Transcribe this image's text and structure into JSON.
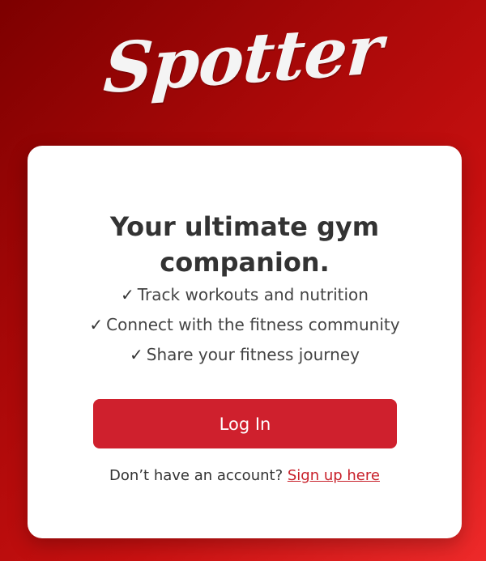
{
  "brand": {
    "logo_text": "Spotter",
    "background_gradient": [
      "#7d0000",
      "#a80808",
      "#c81010",
      "#ee2a2a"
    ]
  },
  "card": {
    "headline": "Your ultimate gym companion.",
    "features": [
      {
        "icon": "checkmark-icon",
        "check": "✓",
        "text": "Track workouts and nutrition"
      },
      {
        "icon": "checkmark-icon",
        "check": "✓",
        "text": "Connect with the fitness community"
      },
      {
        "icon": "checkmark-icon",
        "check": "✓",
        "text": "Share your fitness journey"
      }
    ],
    "login_button_label": "Log In",
    "login_button_color": "#cf202d",
    "signup_prompt": "Don’t have an account?",
    "signup_link_label": "Sign up here",
    "signup_link_color": "#c8202a"
  }
}
